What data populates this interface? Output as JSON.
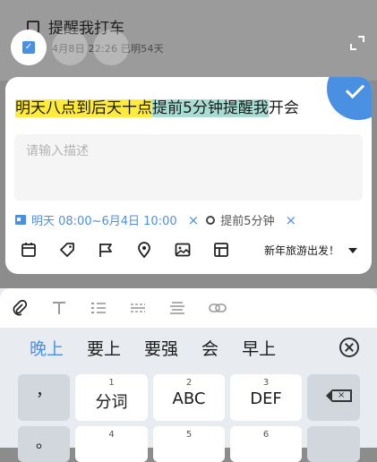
{
  "background_task": {
    "title": "提醒我打车",
    "meta": "4月8日 22:26  已明54天"
  },
  "quick_add": {
    "title_highlight_date": "明天八点到后天十点",
    "title_highlight_reminder": "提前5分钟提醒我",
    "title_rest": "开会",
    "description_placeholder": "请输入描述",
    "date_chip": "明天 08:00~6月4日 10:00",
    "reminder_chip": "提前5分钟",
    "close_glyph": "×",
    "project_name": "新年旅游出发！"
  },
  "keyboard": {
    "candidates": [
      "晚上",
      "要上",
      "要强",
      "会",
      "早上"
    ],
    "keys_row1": [
      {
        "num": "",
        "label": "，"
      },
      {
        "num": "1",
        "label": "分词"
      },
      {
        "num": "2",
        "label": "ABC"
      },
      {
        "num": "3",
        "label": "DEF"
      }
    ],
    "keys_row2": [
      {
        "num": "",
        "label": "。"
      },
      {
        "num": "4",
        "label": ""
      },
      {
        "num": "5",
        "label": ""
      },
      {
        "num": "6",
        "label": ""
      }
    ]
  },
  "colors": {
    "accent": "#4a90e2",
    "highlight_date": "#ffeb3b",
    "highlight_reminder": "#a8ddd3"
  }
}
